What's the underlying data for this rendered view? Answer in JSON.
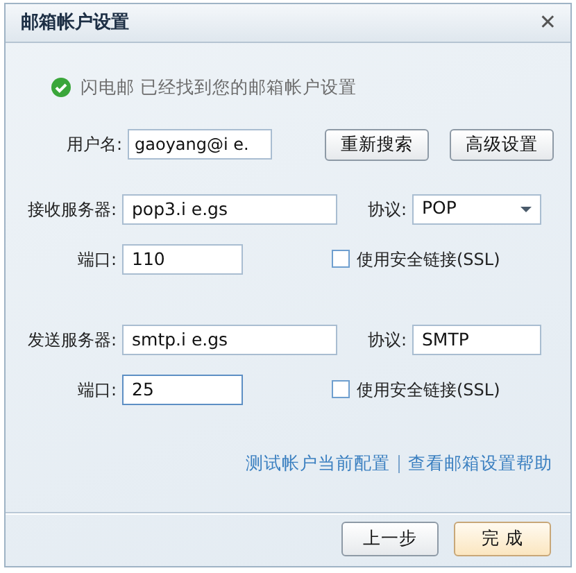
{
  "window": {
    "title": "邮箱帐户设置",
    "close": "✕"
  },
  "status": {
    "ok": true,
    "text": "闪电邮 已经找到您的邮箱帐户设置"
  },
  "account": {
    "label": "用户名:",
    "value": "gaoyang@i e."
  },
  "account_buttons": [
    "重新搜索",
    "高级设置"
  ],
  "servers": [
    {
      "server_label": "接收服务器:",
      "server": "pop3.i e.gs",
      "protocol_label": "协议:",
      "protocol": "POP",
      "protocol_dropdown": true,
      "port_label": "端口:",
      "port": "110",
      "port_focused": false,
      "ssl_label": "使用安全链接(SSL)",
      "ssl_checked": false
    },
    {
      "server_label": "发送服务器:",
      "server": "smtp.i e.gs",
      "protocol_label": "协议:",
      "protocol": "SMTP",
      "protocol_dropdown": false,
      "port_label": "端口:",
      "port": "25",
      "port_focused": true,
      "ssl_label": "使用安全链接(SSL)",
      "ssl_checked": false
    }
  ],
  "links": [
    "测试帐户当前配置",
    "查看邮箱设置帮助"
  ],
  "footer_buttons": [
    {
      "label": "上一步",
      "primary": false
    },
    {
      "label": "完 成",
      "primary": true
    }
  ]
}
